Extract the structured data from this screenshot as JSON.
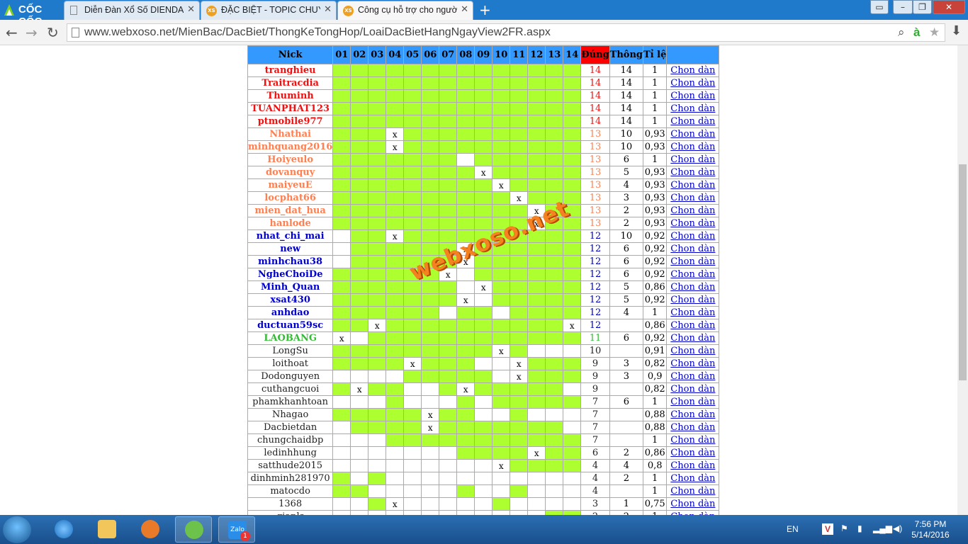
{
  "browser": {
    "logo_text": "CỐC CỐC",
    "tabs": [
      {
        "title": "Diễn Đàn Xổ Số DIENDANXOSO.NET"
      },
      {
        "title": "ĐẶC BIỆT - TOPIC CHUYÊN"
      },
      {
        "title": "Công cụ hỗ trợ cho người chơi"
      }
    ],
    "url": "www.webxoso.net/MienBac/DacBiet/ThongKeTongHop/LoaiDacBietHangNgayView2FR.aspx"
  },
  "table": {
    "headers": {
      "nick": "Nick",
      "days": [
        "01",
        "02",
        "03",
        "04",
        "05",
        "06",
        "07",
        "08",
        "09",
        "10",
        "11",
        "12",
        "13",
        "14"
      ],
      "dung": "Đúng",
      "thong": "Thông",
      "tile": "Tỉ lệ"
    },
    "link_label": "Chon dàn",
    "rows": [
      {
        "nick": "tranghieu",
        "cls": "red",
        "cells": "gggggggggggggg",
        "dung": "14",
        "thong": "14",
        "tile": "1"
      },
      {
        "nick": "Traitracdia",
        "cls": "red",
        "cells": "gggggggggggggg",
        "dung": "14",
        "thong": "14",
        "tile": "1"
      },
      {
        "nick": "Thuminh",
        "cls": "red",
        "cells": "gggggggggggggg",
        "dung": "14",
        "thong": "14",
        "tile": "1"
      },
      {
        "nick": "TUANPHAT123",
        "cls": "red",
        "cells": "gggggggggggggg",
        "dung": "14",
        "thong": "14",
        "tile": "1"
      },
      {
        "nick": "ptmobile977",
        "cls": "red",
        "cells": "gggggggggggggg",
        "dung": "14",
        "thong": "14",
        "tile": "1"
      },
      {
        "nick": "Nhathai",
        "cls": "orange",
        "cells": "gggXgggggggggg",
        "dung": "13",
        "thong": "10",
        "tile": "0,93"
      },
      {
        "nick": "minhquang2016",
        "cls": "orange",
        "cells": "gggXgggggggggg",
        "dung": "13",
        "thong": "10",
        "tile": "0,93"
      },
      {
        "nick": "Hoiyeulo",
        "cls": "orange",
        "cells": "gggggggwgggggg",
        "dung": "13",
        "thong": "6",
        "tile": "1"
      },
      {
        "nick": "dovanquy",
        "cls": "orange",
        "cells": "ggggggggXggggg",
        "dung": "13",
        "thong": "5",
        "tile": "0,93"
      },
      {
        "nick": "maiyeuE",
        "cls": "orange",
        "cells": "gggggggggXgggg",
        "dung": "13",
        "thong": "4",
        "tile": "0,93"
      },
      {
        "nick": "locphat66",
        "cls": "orange",
        "cells": "ggggggggggXggg",
        "dung": "13",
        "thong": "3",
        "tile": "0,93"
      },
      {
        "nick": "mien_dat_hua",
        "cls": "orange",
        "cells": "gggggggggggXgg",
        "dung": "13",
        "thong": "2",
        "tile": "0,93"
      },
      {
        "nick": "hanlode",
        "cls": "orange",
        "cells": "gggggggggggXgg",
        "dung": "13",
        "thong": "2",
        "tile": "0,93"
      },
      {
        "nick": "nhat_chi_mai",
        "cls": "blue",
        "cells": "wggXgggggggggg",
        "dung": "12",
        "thong": "10",
        "tile": "0,92"
      },
      {
        "nick": "new",
        "cls": "blue",
        "cells": "wggggggXgggggg",
        "dung": "12",
        "thong": "6",
        "tile": "0,92"
      },
      {
        "nick": "minhchau38",
        "cls": "blue",
        "cells": "wggggggXgggggg",
        "dung": "12",
        "thong": "6",
        "tile": "0,92"
      },
      {
        "nick": "NgheChoiDe",
        "cls": "blue",
        "cells": "ggggggXwgggggg",
        "dung": "12",
        "thong": "6",
        "tile": "0,92"
      },
      {
        "nick": "Minh_Quan",
        "cls": "blue",
        "cells": "gggggggwXggggg",
        "dung": "12",
        "thong": "5",
        "tile": "0,86"
      },
      {
        "nick": "xsat430",
        "cls": "blue",
        "cells": "gggggggXwggggg",
        "dung": "12",
        "thong": "5",
        "tile": "0,92"
      },
      {
        "nick": "anhdao",
        "cls": "blue",
        "cells": "ggggggwggwgggg",
        "dung": "12",
        "thong": "4",
        "tile": "1"
      },
      {
        "nick": "ductuan59sc",
        "cls": "blue",
        "cells": "ggXggggggggggX",
        "dung": "12",
        "thong": "",
        "tile": "0,86"
      },
      {
        "nick": "LAOBANG",
        "cls": "green",
        "cells": "Xwgggggggggggg",
        "dung": "11",
        "thong": "6",
        "tile": "0,92"
      },
      {
        "nick": "LongSu",
        "cls": "plain",
        "cells": "gggggggggXgwww",
        "dung": "10",
        "thong": "",
        "tile": "0,91"
      },
      {
        "nick": "loithoat",
        "cls": "plain",
        "cells": "ggggXgggwwXggg",
        "dung": "9",
        "thong": "3",
        "tile": "0,82"
      },
      {
        "nick": "Dodonguyen",
        "cls": "plain",
        "cells": "wwwwgggggwXggg",
        "dung": "9",
        "thong": "3",
        "tile": "0,9"
      },
      {
        "nick": "cuthangcuoi",
        "cls": "plain",
        "cells": "gXggwwgXgggggw",
        "dung": "9",
        "thong": "",
        "tile": "0,82"
      },
      {
        "nick": "phamkhanhtoan",
        "cls": "plain",
        "cells": "wwwgwwwgwggggg",
        "dung": "7",
        "thong": "6",
        "tile": "1"
      },
      {
        "nick": "Nhagao",
        "cls": "plain",
        "cells": "gggggXggwwgwww",
        "dung": "7",
        "thong": "",
        "tile": "0,88"
      },
      {
        "nick": "Dacbietdan",
        "cls": "plain",
        "cells": "wggggXgggggggw",
        "dung": "7",
        "thong": "",
        "tile": "0,88"
      },
      {
        "nick": "chungchaidbp",
        "cls": "plain",
        "cells": "wwwggggggggggg",
        "dung": "7",
        "thong": "",
        "tile": "1"
      },
      {
        "nick": "ledinhhung",
        "cls": "plain",
        "cells": "wwwwwwwggggXgg",
        "dung": "6",
        "thong": "2",
        "tile": "0,86"
      },
      {
        "nick": "satthude2015",
        "cls": "plain",
        "cells": "wwwwwwwwwXgggg",
        "dung": "4",
        "thong": "4",
        "tile": "0,8"
      },
      {
        "nick": "dinhminh281970",
        "cls": "plain",
        "cells": "gwgwwwwwwwwwww",
        "dung": "4",
        "thong": "2",
        "tile": "1"
      },
      {
        "nick": "matocdo",
        "cls": "plain",
        "cells": "ggwwwwwgwwgwww",
        "dung": "4",
        "thong": "",
        "tile": "1"
      },
      {
        "nick": "1368",
        "cls": "plain",
        "cells": "wwgXwwwwwgwwww",
        "dung": "3",
        "thong": "1",
        "tile": "0,75"
      },
      {
        "nick": "giapls",
        "cls": "plain",
        "cells": "wwwwwwwwwwwwgg",
        "dung": "2",
        "thong": "2",
        "tile": "1"
      }
    ]
  },
  "watermark": "webxoso.net",
  "taskbar": {
    "lang": "EN",
    "time": "7:56 PM",
    "date": "5/14/2016",
    "zalo_badge": "1",
    "zalo_label": "Zalo"
  },
  "colors": {
    "header": "#3399ff",
    "dung_header": "#ff0000",
    "hit": "#adff2f",
    "red": "#ee1111",
    "orange": "#ff7f50",
    "blue": "#0000cc",
    "green": "#33bb33"
  }
}
